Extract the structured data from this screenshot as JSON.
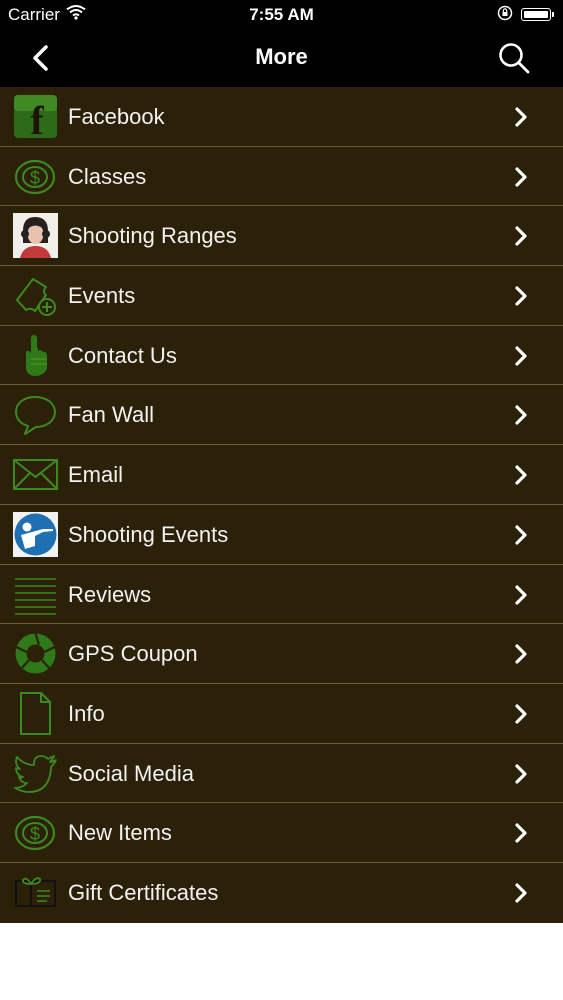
{
  "status_bar": {
    "carrier": "Carrier",
    "time": "7:55 AM"
  },
  "nav": {
    "title": "More",
    "back_icon": "chevron-left-icon",
    "search_icon": "search-icon"
  },
  "colors": {
    "list_background": "#2b2008",
    "icon_green": "#3d8a1e",
    "divider": "#6a5a39",
    "bar_background": "#000000"
  },
  "menu": {
    "items": [
      {
        "label": "Facebook",
        "icon": "facebook-icon"
      },
      {
        "label": "Classes",
        "icon": "dollar-coin-icon"
      },
      {
        "label": "Shooting Ranges",
        "icon": "person-photo-icon"
      },
      {
        "label": "Events",
        "icon": "ticket-add-icon"
      },
      {
        "label": "Contact Us",
        "icon": "pointing-hand-icon"
      },
      {
        "label": "Fan Wall",
        "icon": "speech-bubble-icon"
      },
      {
        "label": "Email",
        "icon": "envelope-icon"
      },
      {
        "label": "Shooting Events",
        "icon": "shooter-badge-icon"
      },
      {
        "label": "Reviews",
        "icon": "lines-icon"
      },
      {
        "label": "GPS Coupon",
        "icon": "aperture-icon"
      },
      {
        "label": "Info",
        "icon": "document-icon"
      },
      {
        "label": "Social Media",
        "icon": "bird-icon"
      },
      {
        "label": "New Items",
        "icon": "dollar-coin-icon"
      },
      {
        "label": "Gift Certificates",
        "icon": "gift-card-icon"
      }
    ]
  }
}
